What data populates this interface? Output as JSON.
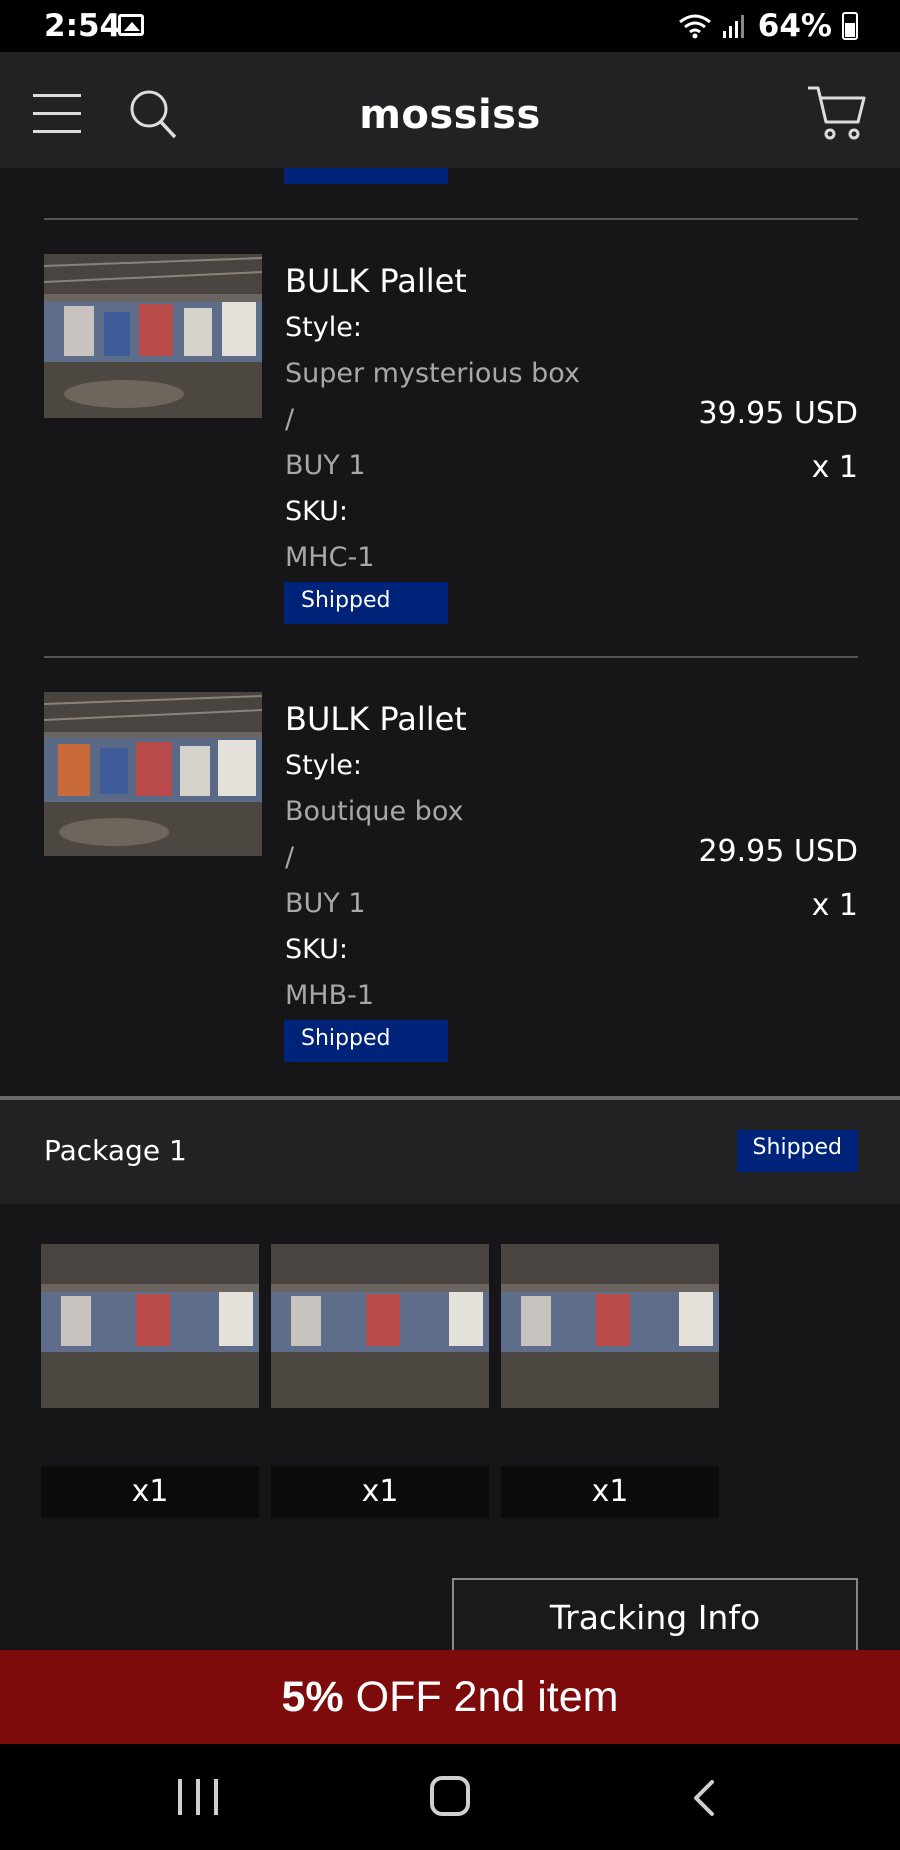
{
  "status_bar": {
    "time": "2:54",
    "battery": "64%"
  },
  "header": {
    "brand": "mossiss"
  },
  "items": [
    {
      "title": "BULK Pallet",
      "style_label": "Style:",
      "style_value": "Super mysterious box",
      "slash": "/",
      "option": "BUY 1",
      "sku_label": "SKU:",
      "sku_value": "MHC-1",
      "price": "39.95 USD",
      "qty": "x 1",
      "status": "Shipped"
    },
    {
      "title": "BULK Pallet",
      "style_label": "Style:",
      "style_value": "Boutique box",
      "slash": "/",
      "option": "BUY 1",
      "sku_label": "SKU:",
      "sku_value": "MHB-1",
      "price": "29.95 USD",
      "qty": "x 1",
      "status": "Shipped"
    }
  ],
  "package": {
    "title": "Package 1",
    "status": "Shipped",
    "quantities": [
      "x1",
      "x1",
      "x1"
    ],
    "tracking_label": "Tracking Info"
  },
  "promo": {
    "bold": "5%",
    "rest": " OFF 2nd item"
  },
  "colors": {
    "badge": "#00237a",
    "promo": "#7d0b0c",
    "background": "#161618"
  }
}
